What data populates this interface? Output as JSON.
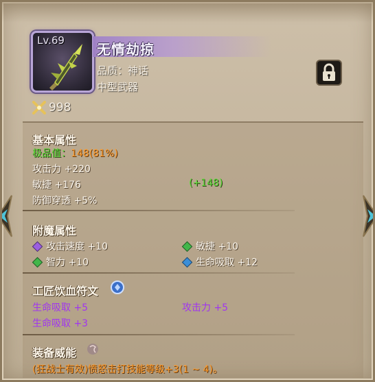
{
  "item": {
    "level": "Lv.69",
    "name": "无情劫掠",
    "quality": "品质：神话",
    "type": "中型武器",
    "price": "998"
  },
  "basic": {
    "title": "基本属性",
    "quality_label": "极品值：",
    "quality_value": "148(81%)",
    "attack": "攻击力 +220",
    "agility": "敏捷 +176",
    "agility_bonus": "(+148)",
    "penetration": "防御穿透 +5%"
  },
  "enchant": {
    "title": "附魔属性",
    "items": [
      {
        "label": "攻击速度 +10",
        "gem": "purple-gem-icon"
      },
      {
        "label": "敏捷 +10",
        "gem": "green-gem-icon"
      },
      {
        "label": "智力 +10",
        "gem": "green-gem-icon"
      },
      {
        "label": "生命吸取 +12",
        "gem": "blue-gem-icon"
      }
    ]
  },
  "rune": {
    "title": "工匠饮血符文",
    "items": [
      "生命吸取 +5",
      "攻击力 +5",
      "生命吸取 +3"
    ]
  },
  "power": {
    "title": "装备威能",
    "desc": "(狂战士有效)愤怒击打技能等级+3(1 ~ 4)。"
  },
  "colors": {
    "green": "#5fdc3a",
    "orange": "#ff9b2b",
    "purple": "#a035ef",
    "frame_mythic": "#b9a6d8"
  }
}
